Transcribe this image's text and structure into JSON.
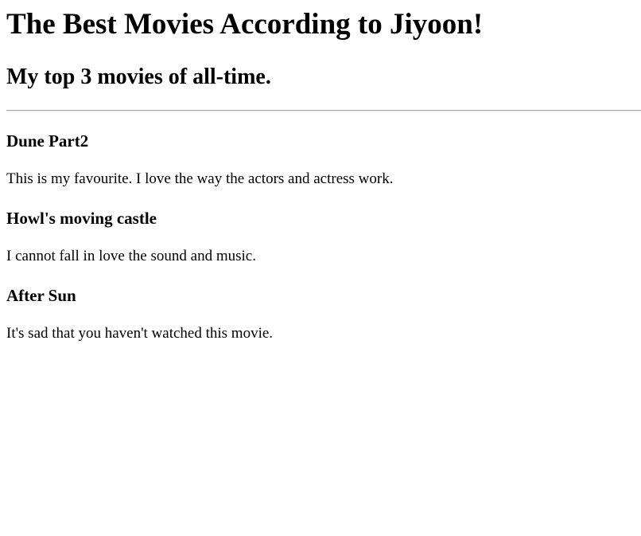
{
  "page": {
    "title": "The Best Movies According to Jiyoon!",
    "subtitle": "My top 3 movies of all-time."
  },
  "movies": [
    {
      "title": "Dune Part2",
      "description": "This is my favourite. I love the way the actors and actress work."
    },
    {
      "title": "Howl's moving castle",
      "description": "I cannot fall in love the sound and music."
    },
    {
      "title": "After Sun",
      "description": "It's sad that you haven't watched this movie."
    }
  ]
}
